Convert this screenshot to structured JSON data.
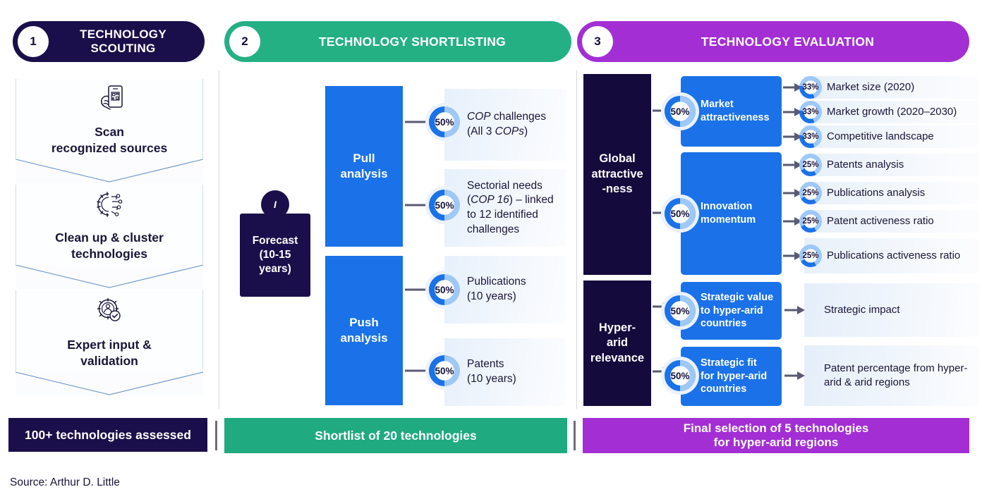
{
  "colors": {
    "navy": "#1a0f4a",
    "green": "#25b084",
    "purple": "#a32fd4",
    "blue": "#1b72e8",
    "light_blue": "#9ec8f6"
  },
  "stages": [
    {
      "number": "1",
      "title": "TECHNOLOGY\nSCOUTING"
    },
    {
      "number": "2",
      "title": "TECHNOLOGY SHORTLISTING"
    },
    {
      "number": "3",
      "title": "TECHNOLOGY EVALUATION"
    }
  ],
  "stage1": {
    "steps": [
      {
        "icon": "phone-scan-icon",
        "label": "Scan\nrecognized sources"
      },
      {
        "icon": "gear-circuit-icon",
        "label": "Clean up & cluster\ntechnologies"
      },
      {
        "icon": "expert-gear-check-icon",
        "label": "Expert input &\nvalidation"
      }
    ]
  },
  "stage2": {
    "forecast": {
      "marker": "I",
      "label": "Forecast\n(10-15\nyears)"
    },
    "branches": [
      {
        "name": "Pull\nanalysis"
      },
      {
        "name": "Push\nanalysis"
      }
    ],
    "outcomes": [
      {
        "pct": "50%",
        "text_html": "<i>COP</i> challenges<br>(All 3 <i>COPs</i>)"
      },
      {
        "pct": "50%",
        "text_html": "Sectorial needs<br>(<i>COP 16</i>) &ndash; linked<br>to 12 identified<br>challenges"
      },
      {
        "pct": "50%",
        "text_html": "Publications<br>(10 years)"
      },
      {
        "pct": "50%",
        "text_html": "Patents<br>(10 years)"
      }
    ]
  },
  "stage3": {
    "pillars": [
      {
        "label": "Global\nattractive\n-ness"
      },
      {
        "label": "Hyper-\narid\nrelevance"
      }
    ],
    "criteria": [
      {
        "pct": "50%",
        "label": "Market\nattractiveness"
      },
      {
        "pct": "50%",
        "label": "Innovation\nmomentum"
      },
      {
        "pct": "50%",
        "label": "Strategic value\nto hyper-arid\ncountries"
      },
      {
        "pct": "50%",
        "label": "Strategic fit\nfor hyper-arid\ncountries"
      }
    ],
    "metrics_market": [
      {
        "pct": "33%",
        "label": "Market size (2020)"
      },
      {
        "pct": "33%",
        "label": "Market growth (2020–2030)"
      },
      {
        "pct": "33%",
        "label": "Competitive landscape"
      }
    ],
    "metrics_innovation": [
      {
        "pct": "25%",
        "label": "Patents analysis"
      },
      {
        "pct": "25%",
        "label": "Publications analysis"
      },
      {
        "pct": "25%",
        "label": "Patent activeness ratio"
      },
      {
        "pct": "25%",
        "label": "Publications activeness ratio"
      }
    ],
    "outcomes": [
      {
        "label": "Strategic impact"
      },
      {
        "label": "Patent percentage from hyper-arid & arid regions"
      }
    ]
  },
  "footers": [
    {
      "label": "100+ technologies assessed"
    },
    {
      "label": "Shortlist of 20 technologies"
    },
    {
      "label": "Final selection of 5 technologies\nfor hyper-arid regions"
    }
  ],
  "source": "Source: Arthur D. Little"
}
